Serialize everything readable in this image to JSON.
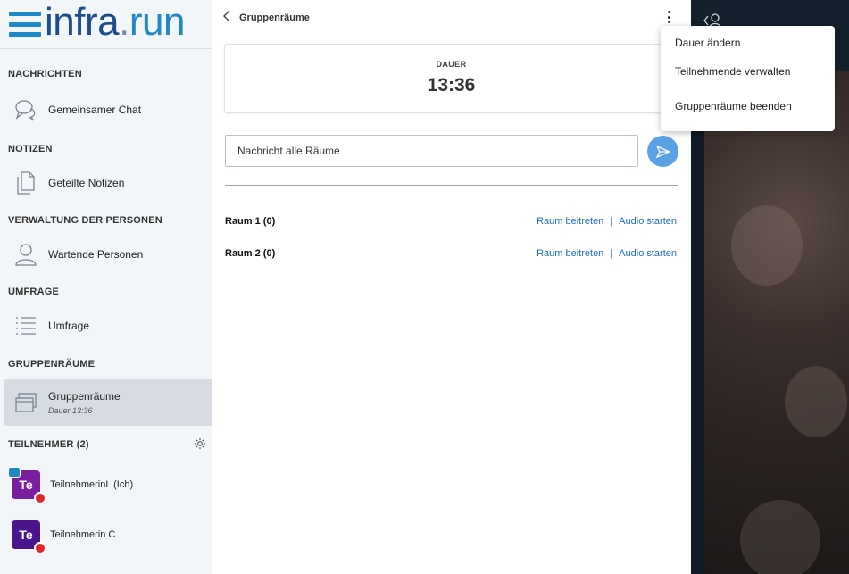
{
  "logo": {
    "part1": "infra",
    "dot": ".",
    "part2": "run"
  },
  "sidebar": {
    "sections": {
      "messages": "NACHRICHTEN",
      "notes": "NOTIZEN",
      "people": "VERWALTUNG DER PERSONEN",
      "poll": "UMFRAGE",
      "breakout": "GRUPPENRÄUME",
      "participants": "TEILNEHMER (2)"
    },
    "items": {
      "chat": "Gemeinsamer Chat",
      "notes": "Geteilte Notizen",
      "waiting": "Wartende Personen",
      "poll": "Umfrage",
      "breakout": "Gruppenräume",
      "breakout_sub": "Dauer 13:36"
    },
    "users": [
      {
        "initials": "Te",
        "name": "TeilnehmerinL (Ich)",
        "color": "#7b1fa2"
      },
      {
        "initials": "Te",
        "name": "Teilnehmerin C",
        "color": "#4a148c"
      }
    ]
  },
  "panel": {
    "title": "Gruppenräume",
    "duration_label": "DAUER",
    "duration_value": "13:36",
    "message_placeholder": "Nachricht alle Räume",
    "rooms": [
      {
        "name": "Raum 1 (0)",
        "join": "Raum beitreten",
        "audio": "Audio starten"
      },
      {
        "name": "Raum 2 (0)",
        "join": "Raum beitreten",
        "audio": "Audio starten"
      }
    ]
  },
  "menu": {
    "items": [
      "Dauer ändern",
      "Teilnehmende verwalten",
      "Gruppenräume beenden"
    ]
  },
  "colors": {
    "accent": "#1e88c8",
    "send": "#5ba1e6",
    "link": "#1a6fc2",
    "lock": "#e0262f"
  }
}
